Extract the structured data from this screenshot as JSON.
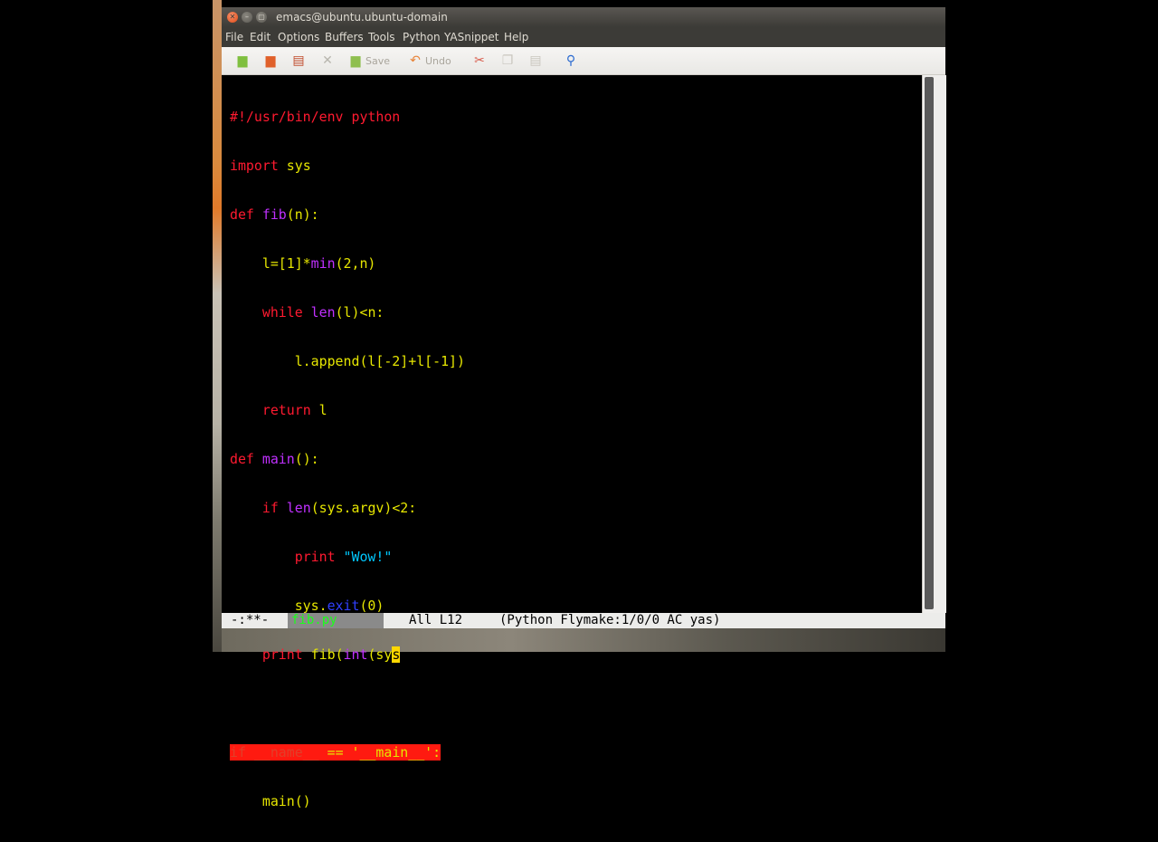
{
  "window": {
    "title": "emacs@ubuntu.ubuntu-domain"
  },
  "menubar": {
    "items": [
      "File",
      "Edit",
      "Options",
      "Buffers",
      "Tools",
      "Python",
      "YASnippet",
      "Help"
    ]
  },
  "toolbar": {
    "save_label": "Save",
    "undo_label": "Undo",
    "icons": [
      "new-file-icon",
      "open-folder-icon",
      "dired-icon",
      "close-icon",
      "save-icon",
      "undo-icon",
      "cut-icon",
      "copy-icon",
      "paste-icon",
      "search-icon"
    ]
  },
  "code": {
    "lines": [
      "#!/usr/bin/env python",
      "import sys",
      "def fib(n):",
      "    l=[1]*min(2,n)",
      "    while len(l)<n:",
      "        l.append(l[-2]+l[-1])",
      "    return l",
      "def main():",
      "    if len(sys.argv)<2:",
      "        print \"Wow!\"",
      "        sys.exit(0)",
      "    print fib(int(sys",
      "",
      "if __name__ == '__main__':",
      "    main()"
    ]
  },
  "modeline": {
    "status": "-:**-",
    "buffer_name": "fib.py",
    "position": "All L12",
    "modes": "(Python Flymake:1/0/0 AC yas)"
  },
  "colors": {
    "keyword": "#ff1a30",
    "function": "#c030ff",
    "string": "#00c8ff",
    "default_text": "#e6e600",
    "cursor": "#ffd700",
    "error_highlight": "#ff1a10",
    "buffer_name": "#1aff1a"
  }
}
